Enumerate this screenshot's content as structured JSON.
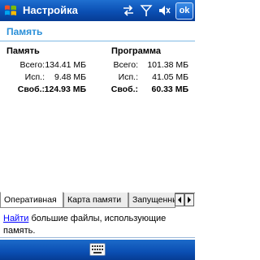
{
  "titlebar": {
    "title": "Настройка",
    "ok_label": "ok",
    "icons": [
      "windows-start-icon",
      "sync-arrows-icon",
      "signal-antenna-icon",
      "speaker-mute-icon"
    ]
  },
  "page": {
    "title": "Память"
  },
  "storage": {
    "heading": "Память",
    "labels": {
      "total": "Всего:",
      "used": "Исп.:",
      "free": "Своб.:"
    },
    "total": "134.41 МБ",
    "used": "9.48 МБ",
    "free": "124.93 МБ"
  },
  "program": {
    "heading": "Программа",
    "labels": {
      "total": "Всего:",
      "used": "Исп.:",
      "free": "Своб.:"
    },
    "total": "101.38 МБ",
    "used": "41.05 МБ",
    "free": "60.33 МБ"
  },
  "tabs": [
    {
      "label": "Оперативная",
      "active": true
    },
    {
      "label": "Карта памяти",
      "active": false
    },
    {
      "label": "Запущенные",
      "active": false
    }
  ],
  "help": {
    "link": "Найти",
    "text": " большие файлы, использующие память."
  },
  "menubar": {
    "icon": "keyboard-icon"
  },
  "colors": {
    "titlebar": "#0b4fb3",
    "page_title": "#2a8fd8",
    "link": "#0000ff"
  }
}
